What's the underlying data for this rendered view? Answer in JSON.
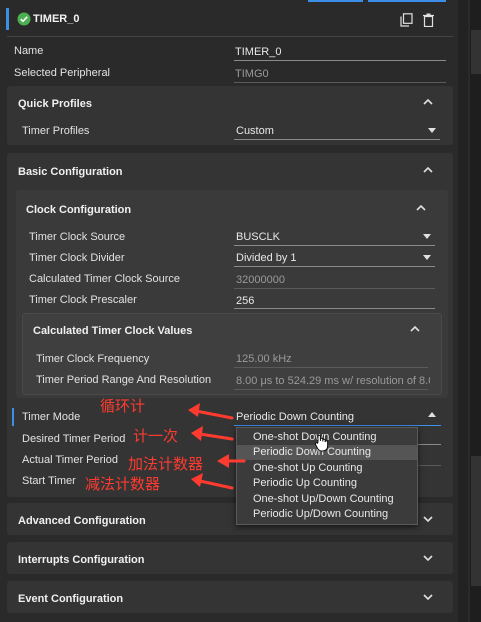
{
  "header": {
    "title": "TIMER_0"
  },
  "top_fields": [
    {
      "label": "Name",
      "value": "TIMER_0"
    },
    {
      "label": "Selected Peripheral",
      "value": "TIMG0"
    }
  ],
  "quick_profiles": {
    "title": "Quick Profiles",
    "field_label": "Timer Profiles",
    "field_value": "Custom"
  },
  "basic": {
    "title": "Basic Configuration",
    "clock": {
      "title": "Clock Configuration",
      "fields": [
        {
          "label": "Timer Clock Source",
          "value": "BUSCLK"
        },
        {
          "label": "Timer Clock Divider",
          "value": "Divided by 1"
        },
        {
          "label": "Calculated Timer Clock Source",
          "value": "32000000"
        },
        {
          "label": "Timer Clock Prescaler",
          "value": "256"
        }
      ],
      "calc": {
        "title": "Calculated Timer Clock Values",
        "fields": [
          {
            "label": "Timer Clock Frequency",
            "value": "125.00 kHz"
          },
          {
            "label": "Timer Period Range And Resolution",
            "value": "8.00 μs to 524.29 ms w/ resolution of 8.0"
          }
        ]
      }
    },
    "mode_label": "Timer Mode",
    "mode_value": "Periodic Down Counting",
    "desired_label": "Desired Timer Period",
    "actual_label": "Actual Timer Period",
    "start_label": "Start Timer"
  },
  "dropdown": {
    "options": [
      "One-shot Down Counting",
      "Periodic Down Counting",
      "One-shot Up Counting",
      "Periodic Up Counting",
      "One-shot Up/Down Counting",
      "Periodic Up/Down Counting"
    ],
    "highlighted_index": 1
  },
  "sections": {
    "advanced": "Advanced Configuration",
    "interrupts": "Interrupts Configuration",
    "event": "Event Configuration"
  },
  "annotations": [
    "循环计",
    "计一次",
    "加法计数器",
    "减法计数器"
  ],
  "colors": {
    "accent": "#3d8ee6",
    "annotation": "#ff3b30",
    "check": "#4caf50",
    "highlight": "#555555"
  },
  "icons": [
    "check-circle-icon",
    "copy-icon",
    "trash-icon",
    "chevron-up-icon",
    "chevron-down-icon",
    "cursor-icon"
  ]
}
